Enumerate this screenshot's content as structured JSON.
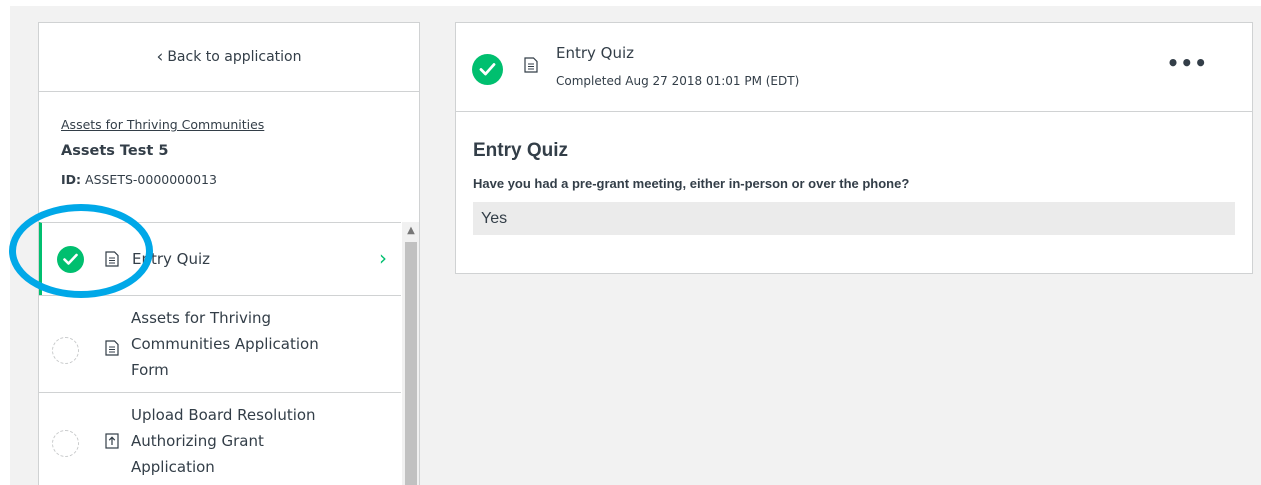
{
  "sidebar": {
    "back_label": "Back to application",
    "program_name": "Assets for Thriving Communities",
    "application_name": "Assets Test 5",
    "id_label": "ID:",
    "id_value": "ASSETS-0000000013",
    "tasks": [
      {
        "label": "Entry Quiz",
        "status": "completed",
        "icon": "document-icon",
        "active": true
      },
      {
        "label_lines": [
          "Assets for Thriving",
          "Communities Application",
          "Form"
        ],
        "status": "pending",
        "icon": "document-icon"
      },
      {
        "label_lines": [
          "Upload Board Resolution",
          "Authorizing Grant",
          "Application"
        ],
        "status": "pending",
        "icon": "upload-icon"
      }
    ]
  },
  "header": {
    "title": "Entry Quiz",
    "subtitle": "Completed Aug 27 2018 01:01 PM (EDT)",
    "more_label": "•••"
  },
  "quiz": {
    "title": "Entry Quiz",
    "question": "Have you had a pre-grant meeting, either in-person or over the phone?",
    "answer": "Yes"
  },
  "colors": {
    "accent_green": "#00bf6f",
    "highlight_blue": "#00a8e8",
    "border": "#d0d2d3",
    "background": "#f2f2f2"
  }
}
